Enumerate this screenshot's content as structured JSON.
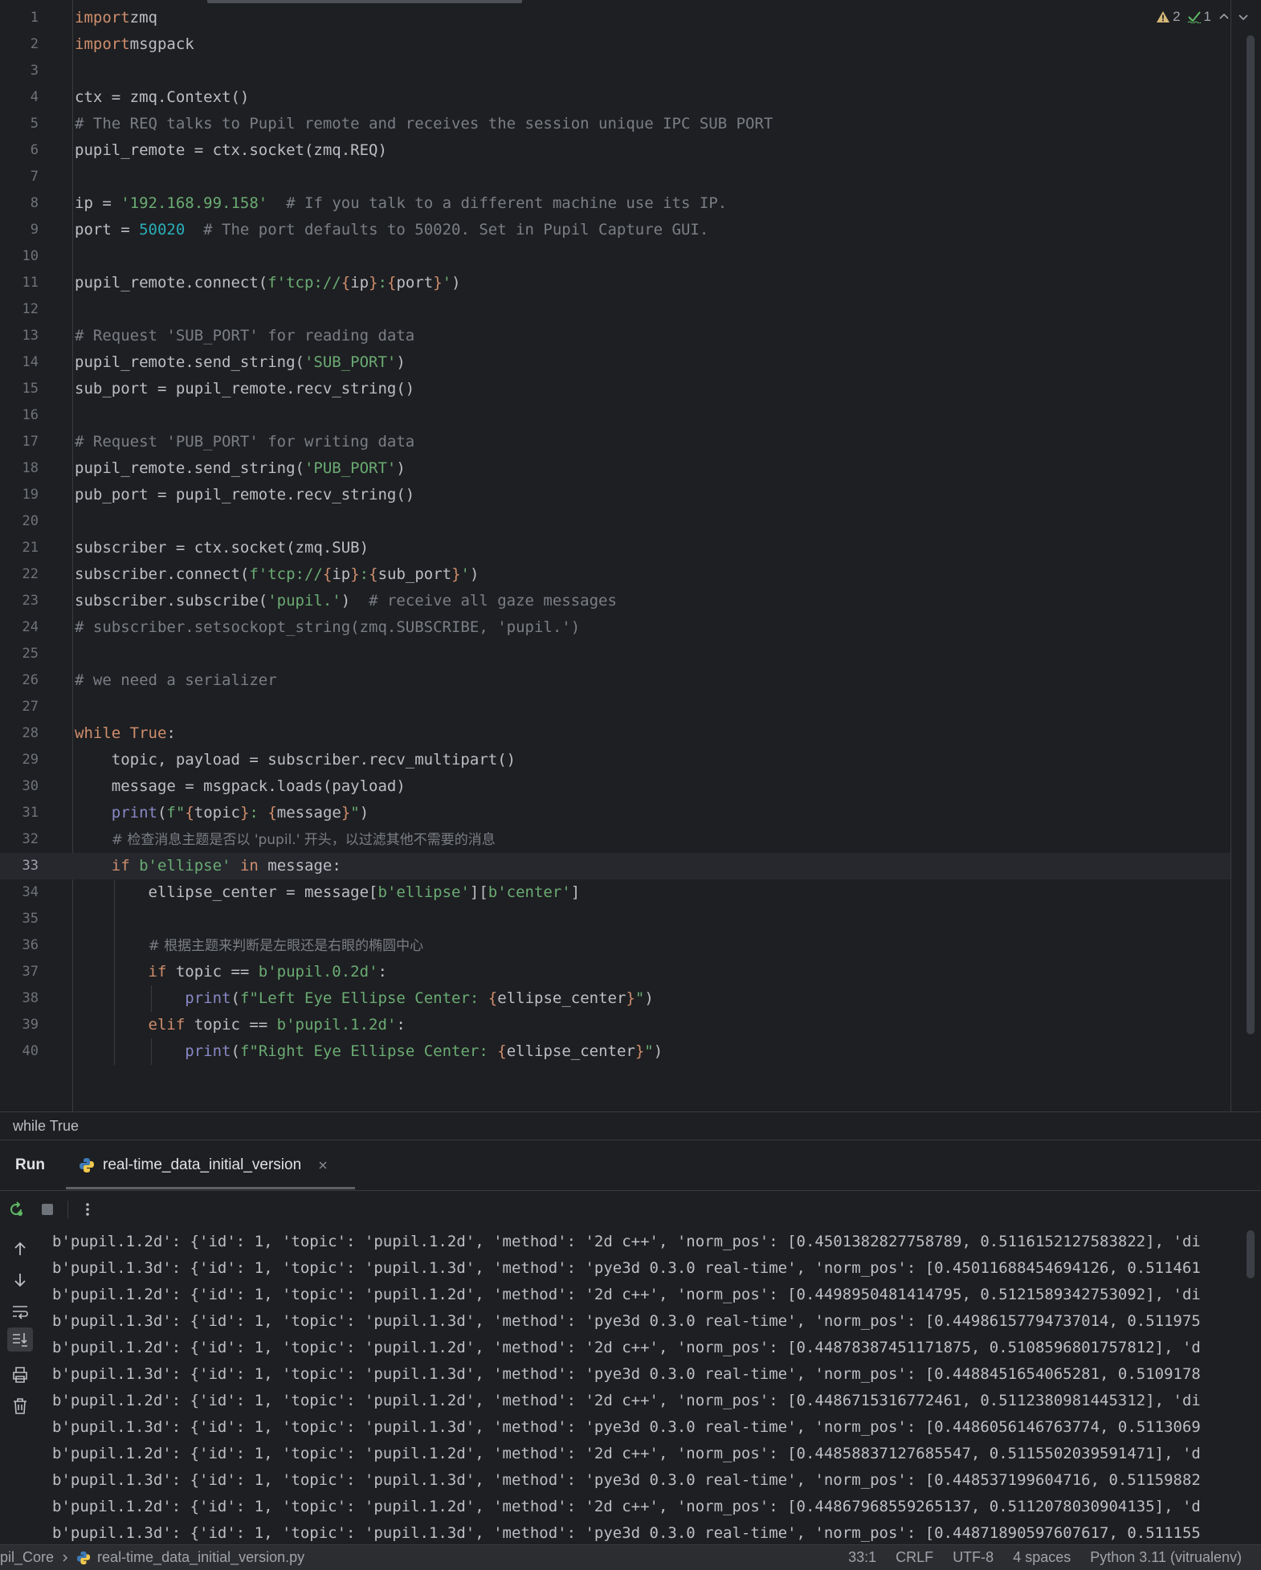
{
  "editor": {
    "inspections": {
      "warnings": "2",
      "weak_warnings": "1"
    },
    "lines": [
      {
        "n": "1",
        "segs": [
          [
            "kw",
            "import"
          ],
          [
            "",
            "zmq"
          ]
        ]
      },
      {
        "n": "2",
        "segs": [
          [
            "kw",
            "import"
          ],
          [
            "",
            "msgpack"
          ]
        ]
      },
      {
        "n": "3",
        "segs": []
      },
      {
        "n": "4",
        "segs": [
          [
            "",
            "ctx = zmq.Context()"
          ]
        ]
      },
      {
        "n": "5",
        "segs": [
          [
            "cmt",
            "# The REQ talks to Pupil remote and receives the session unique IPC SUB PORT"
          ]
        ]
      },
      {
        "n": "6",
        "segs": [
          [
            "",
            "pupil_remote = ctx.socket(zmq.REQ)"
          ]
        ]
      },
      {
        "n": "7",
        "segs": []
      },
      {
        "n": "8",
        "segs": [
          [
            "",
            "ip = "
          ],
          [
            "str",
            "'192.168.99.158'"
          ],
          [
            "",
            "  "
          ],
          [
            "cmt",
            "# If you talk to a different machine use its IP."
          ]
        ]
      },
      {
        "n": "9",
        "segs": [
          [
            "",
            "port = "
          ],
          [
            "num",
            "50020"
          ],
          [
            "",
            "  "
          ],
          [
            "cmt",
            "# The port defaults to 50020. Set in Pupil Capture GUI."
          ]
        ]
      },
      {
        "n": "10",
        "segs": []
      },
      {
        "n": "11",
        "segs": [
          [
            "",
            "pupil_remote.connect("
          ],
          [
            "str",
            "f'tcp://"
          ],
          [
            "fmt",
            "{"
          ],
          [
            "",
            "ip"
          ],
          [
            "fmt",
            "}"
          ],
          [
            "str",
            ":"
          ],
          [
            "fmt",
            "{"
          ],
          [
            "",
            "port"
          ],
          [
            "fmt",
            "}"
          ],
          [
            "str",
            "'"
          ],
          [
            "",
            ")"
          ]
        ]
      },
      {
        "n": "12",
        "segs": []
      },
      {
        "n": "13",
        "segs": [
          [
            "cmt",
            "# Request 'SUB_PORT' for reading data"
          ]
        ]
      },
      {
        "n": "14",
        "segs": [
          [
            "",
            "pupil_remote.send_string("
          ],
          [
            "str",
            "'SUB_PORT'"
          ],
          [
            "",
            ")"
          ]
        ]
      },
      {
        "n": "15",
        "segs": [
          [
            "",
            "sub_port = pupil_remote.recv_string()"
          ]
        ]
      },
      {
        "n": "16",
        "segs": []
      },
      {
        "n": "17",
        "segs": [
          [
            "cmt",
            "# Request 'PUB_PORT' for writing data"
          ]
        ]
      },
      {
        "n": "18",
        "segs": [
          [
            "",
            "pupil_remote.send_string("
          ],
          [
            "str",
            "'PUB_PORT'"
          ],
          [
            "",
            ")"
          ]
        ]
      },
      {
        "n": "19",
        "segs": [
          [
            "",
            "pub_port = pupil_remote.recv_string()"
          ]
        ]
      },
      {
        "n": "20",
        "segs": []
      },
      {
        "n": "21",
        "segs": [
          [
            "",
            "subscriber = ctx.socket(zmq.SUB)"
          ]
        ]
      },
      {
        "n": "22",
        "segs": [
          [
            "",
            "subscriber.connect("
          ],
          [
            "str",
            "f'tcp://"
          ],
          [
            "fmt",
            "{"
          ],
          [
            "",
            "ip"
          ],
          [
            "fmt",
            "}"
          ],
          [
            "str",
            ":"
          ],
          [
            "fmt",
            "{"
          ],
          [
            "",
            "sub_port"
          ],
          [
            "fmt",
            "}"
          ],
          [
            "str",
            "'"
          ],
          [
            "",
            ")"
          ]
        ]
      },
      {
        "n": "23",
        "segs": [
          [
            "",
            "subscriber.subscribe("
          ],
          [
            "str",
            "'pupil.'"
          ],
          [
            "",
            ")  "
          ],
          [
            "cmt",
            "# receive all gaze messages"
          ]
        ]
      },
      {
        "n": "24",
        "segs": [
          [
            "cmt",
            "# subscriber.setsockopt_string(zmq.SUBSCRIBE, 'pupil.')"
          ]
        ]
      },
      {
        "n": "25",
        "segs": []
      },
      {
        "n": "26",
        "segs": [
          [
            "cmt",
            "# we need a serializer"
          ]
        ]
      },
      {
        "n": "27",
        "segs": []
      },
      {
        "n": "28",
        "segs": [
          [
            "kw",
            "while"
          ],
          [
            "",
            " "
          ],
          [
            "kw",
            "True"
          ],
          [
            "",
            ":"
          ]
        ]
      },
      {
        "n": "29",
        "segs": [
          [
            "",
            "    topic, payload = subscriber.recv_multipart()"
          ]
        ]
      },
      {
        "n": "30",
        "segs": [
          [
            "",
            "    message = msgpack.loads(payload)"
          ]
        ]
      },
      {
        "n": "31",
        "segs": [
          [
            "",
            "    "
          ],
          [
            "builtin",
            "print"
          ],
          [
            "",
            "("
          ],
          [
            "str",
            "f\""
          ],
          [
            "fmt",
            "{"
          ],
          [
            "",
            "topic"
          ],
          [
            "fmt",
            "}"
          ],
          [
            "str",
            ": "
          ],
          [
            "fmt",
            "{"
          ],
          [
            "",
            "message"
          ],
          [
            "fmt",
            "}"
          ],
          [
            "str",
            "\""
          ],
          [
            "",
            ")"
          ]
        ]
      },
      {
        "n": "32",
        "segs": [
          [
            "",
            "    "
          ],
          [
            "cjk",
            "# 检查消息主题是否以 'pupil.' 开头，以过滤其他不需要的消息"
          ]
        ]
      },
      {
        "n": "33",
        "segs": [
          [
            "",
            "    "
          ],
          [
            "kw",
            "if"
          ],
          [
            "",
            " "
          ],
          [
            "str",
            "b'ellipse'"
          ],
          [
            "",
            " "
          ],
          [
            "kw",
            "in"
          ],
          [
            "",
            " message:"
          ]
        ]
      },
      {
        "n": "34",
        "segs": [
          [
            "",
            "        ellipse_center = message["
          ],
          [
            "str",
            "b'ellipse'"
          ],
          [
            "",
            "]["
          ],
          [
            "str",
            "b'center'"
          ],
          [
            "",
            "]"
          ]
        ]
      },
      {
        "n": "35",
        "segs": []
      },
      {
        "n": "36",
        "segs": [
          [
            "",
            "        "
          ],
          [
            "cjk",
            "# 根据主题来判断是左眼还是右眼的椭圆中心"
          ]
        ]
      },
      {
        "n": "37",
        "segs": [
          [
            "",
            "        "
          ],
          [
            "kw",
            "if"
          ],
          [
            "",
            " topic == "
          ],
          [
            "str",
            "b'pupil.0.2d'"
          ],
          [
            "",
            ":"
          ]
        ]
      },
      {
        "n": "38",
        "segs": [
          [
            "",
            "            "
          ],
          [
            "builtin",
            "print"
          ],
          [
            "",
            "("
          ],
          [
            "str",
            "f\"Left Eye Ellipse Center: "
          ],
          [
            "fmt",
            "{"
          ],
          [
            "",
            "ellipse_center"
          ],
          [
            "fmt",
            "}"
          ],
          [
            "str",
            "\""
          ],
          [
            "",
            ")"
          ]
        ]
      },
      {
        "n": "39",
        "segs": [
          [
            "",
            "        "
          ],
          [
            "kw",
            "elif"
          ],
          [
            "",
            " topic == "
          ],
          [
            "str",
            "b'pupil.1.2d'"
          ],
          [
            "",
            ":"
          ]
        ]
      },
      {
        "n": "40",
        "segs": [
          [
            "",
            "            "
          ],
          [
            "builtin",
            "print"
          ],
          [
            "",
            "("
          ],
          [
            "str",
            "f\"Right Eye Ellipse Center: "
          ],
          [
            "fmt",
            "{"
          ],
          [
            "",
            "ellipse_center"
          ],
          [
            "fmt",
            "}"
          ],
          [
            "str",
            "\""
          ],
          [
            "",
            ")"
          ]
        ]
      }
    ]
  },
  "breadcrumb": {
    "scope": "while True"
  },
  "run": {
    "title": "Run",
    "tab_label": "real-time_data_initial_version",
    "console_lines": [
      "b'pupil.1.2d': {'id': 1, 'topic': 'pupil.1.2d', 'method': '2d c++', 'norm_pos': [0.4501382827758789, 0.5116152127583822], 'di",
      "b'pupil.1.3d': {'id': 1, 'topic': 'pupil.1.3d', 'method': 'pye3d 0.3.0 real-time', 'norm_pos': [0.45011688454694126, 0.511461",
      "b'pupil.1.2d': {'id': 1, 'topic': 'pupil.1.2d', 'method': '2d c++', 'norm_pos': [0.4498950481414795, 0.5121589342753092], 'di",
      "b'pupil.1.3d': {'id': 1, 'topic': 'pupil.1.3d', 'method': 'pye3d 0.3.0 real-time', 'norm_pos': [0.44986157794737014, 0.511975",
      "b'pupil.1.2d': {'id': 1, 'topic': 'pupil.1.2d', 'method': '2d c++', 'norm_pos': [0.44878387451171875, 0.5108596801757812], 'd",
      "b'pupil.1.3d': {'id': 1, 'topic': 'pupil.1.3d', 'method': 'pye3d 0.3.0 real-time', 'norm_pos': [0.4488451654065281, 0.5109178",
      "b'pupil.1.2d': {'id': 1, 'topic': 'pupil.1.2d', 'method': '2d c++', 'norm_pos': [0.44867153167724​61, 0.5112380981445312], 'di",
      "b'pupil.1.3d': {'id': 1, 'topic': 'pupil.1.3d', 'method': 'pye3d 0.3.0 real-time', 'norm_pos': [0.4486056146763774, 0.5113069",
      "b'pupil.1.2d': {'id': 1, 'topic': 'pupil.1.2d', 'method': '2d c++', 'norm_pos': [0.448588371276855​47, 0.5115502039591471], 'd",
      "b'pupil.1.3d': {'id': 1, 'topic': 'pupil.1.3d', 'method': 'pye3d 0.3.0 real-time', 'norm_pos': [0.448537199604716, 0.51159882",
      "b'pupil.1.2d': {'id': 1, 'topic': 'pupil.1.2d', 'method': '2d c++', 'norm_pos': [0.44867968559265137, 0.5112078030904135], 'd",
      "b'pupil.1.3d': {'id': 1, 'topic': 'pupil.1.3d', 'method': 'pye3d 0.3.0 real-time', 'norm_pos': [0.44871890597607617, 0.511155"
    ]
  },
  "status": {
    "project": "pil_Core",
    "file": "real-time_data_initial_version.py",
    "position": "33:1",
    "line_sep": "CRLF",
    "encoding": "UTF-8",
    "indent": "4 spaces",
    "interpreter": "Python 3.11 (vitrualenv)"
  },
  "colors": {
    "background": "#1e1f22",
    "keyword": "#cf8e6d",
    "string": "#6aab73",
    "number": "#2aacb8",
    "comment": "#7a7e85",
    "builtin": "#8888c6",
    "warning": "#d5b778"
  },
  "icons": [
    "warning-icon",
    "check-icon",
    "chevron-up-icon",
    "chevron-down-icon",
    "python-file-icon",
    "close-icon",
    "rerun-icon",
    "stop-icon",
    "more-icon",
    "arrow-up-icon",
    "arrow-down-icon",
    "soft-wrap-icon",
    "scroll-to-end-icon",
    "print-icon",
    "trash-icon",
    "chevron-right-icon"
  ]
}
